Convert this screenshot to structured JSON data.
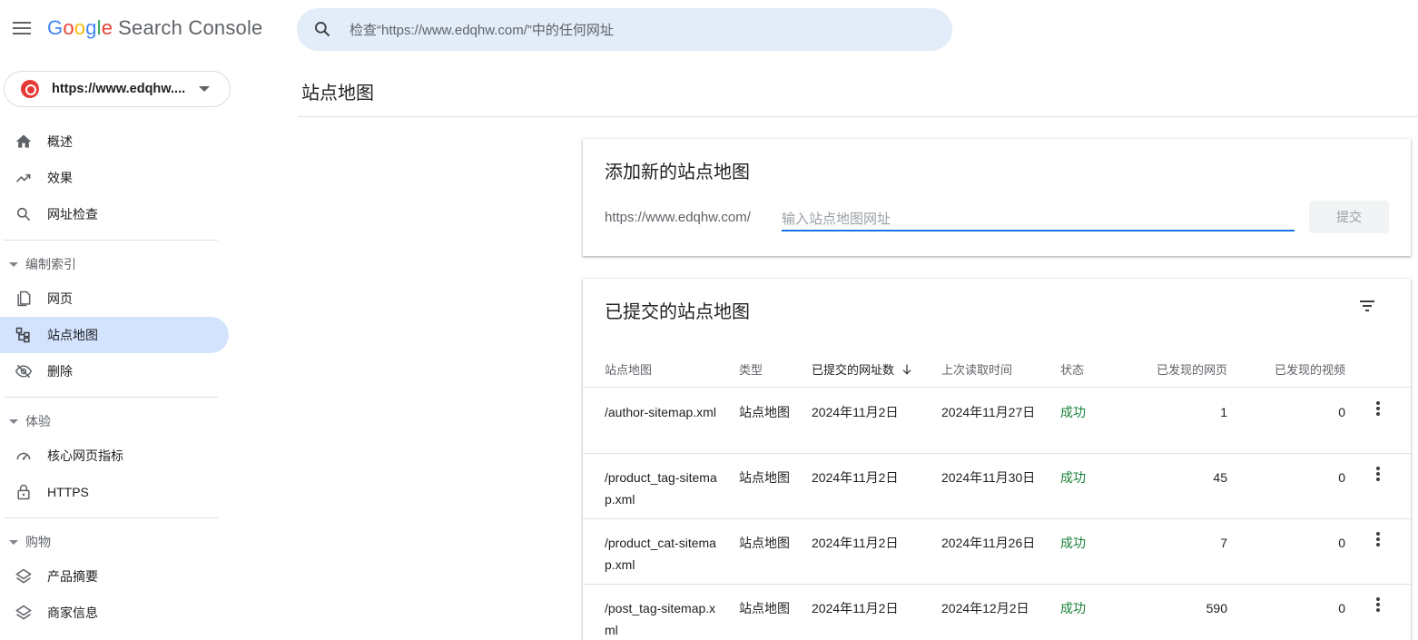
{
  "app": {
    "logo_letters": [
      "G",
      "o",
      "o",
      "g",
      "l",
      "e"
    ],
    "product": "Search Console"
  },
  "search": {
    "placeholder": "检查“https://www.edqhw.com/”中的任何网址"
  },
  "property": {
    "url": "https://www.edqhw...."
  },
  "sidebar": {
    "top_items": [
      {
        "label": "概述",
        "icon": "home-icon"
      },
      {
        "label": "效果",
        "icon": "trending-up-icon"
      },
      {
        "label": "网址检查",
        "icon": "search-icon"
      }
    ],
    "sections": [
      {
        "title": "编制索引",
        "items": [
          {
            "label": "网页",
            "icon": "pages-icon"
          },
          {
            "label": "站点地图",
            "icon": "sitemap-icon",
            "active": true
          },
          {
            "label": "删除",
            "icon": "visibility-off-icon"
          }
        ]
      },
      {
        "title": "体验",
        "items": [
          {
            "label": "核心网页指标",
            "icon": "speed-icon"
          },
          {
            "label": "HTTPS",
            "icon": "lock-icon"
          }
        ]
      },
      {
        "title": "购物",
        "items": [
          {
            "label": "产品摘要",
            "icon": "layers-icon"
          },
          {
            "label": "商家信息",
            "icon": "layers-icon"
          }
        ]
      }
    ]
  },
  "page": {
    "title": "站点地图"
  },
  "add_card": {
    "title": "添加新的站点地图",
    "prefix": "https://www.edqhw.com/",
    "input_placeholder": "输入站点地图网址",
    "submit_label": "提交"
  },
  "list_card": {
    "title": "已提交的站点地图",
    "columns": [
      "站点地图",
      "类型",
      "已提交的网址数",
      "上次读取时间",
      "状态",
      "已发现的网页",
      "已发现的视频"
    ],
    "sorted_column": "已提交的网址数",
    "rows": [
      {
        "sitemap": "/author-sitemap.xml",
        "type": "站点地图",
        "submitted": "2024年11月2日",
        "last_read": "2024年11月27日",
        "status": "成功",
        "pages": "1",
        "videos": "0"
      },
      {
        "sitemap": "/product_tag-sitemap.xml",
        "type": "站点地图",
        "submitted": "2024年11月2日",
        "last_read": "2024年11月30日",
        "status": "成功",
        "pages": "45",
        "videos": "0"
      },
      {
        "sitemap": "/product_cat-sitemap.xml",
        "type": "站点地图",
        "submitted": "2024年11月2日",
        "last_read": "2024年11月26日",
        "status": "成功",
        "pages": "7",
        "videos": "0"
      },
      {
        "sitemap": "/post_tag-sitemap.xml",
        "type": "站点地图",
        "submitted": "2024年11月2日",
        "last_read": "2024年12月2日",
        "status": "成功",
        "pages": "590",
        "videos": "0"
      }
    ]
  },
  "colors": {
    "accent": "#1a73e8",
    "active_nav_bg": "#d3e3fd",
    "search_bg": "#e3ecf9",
    "success": "#188038"
  }
}
